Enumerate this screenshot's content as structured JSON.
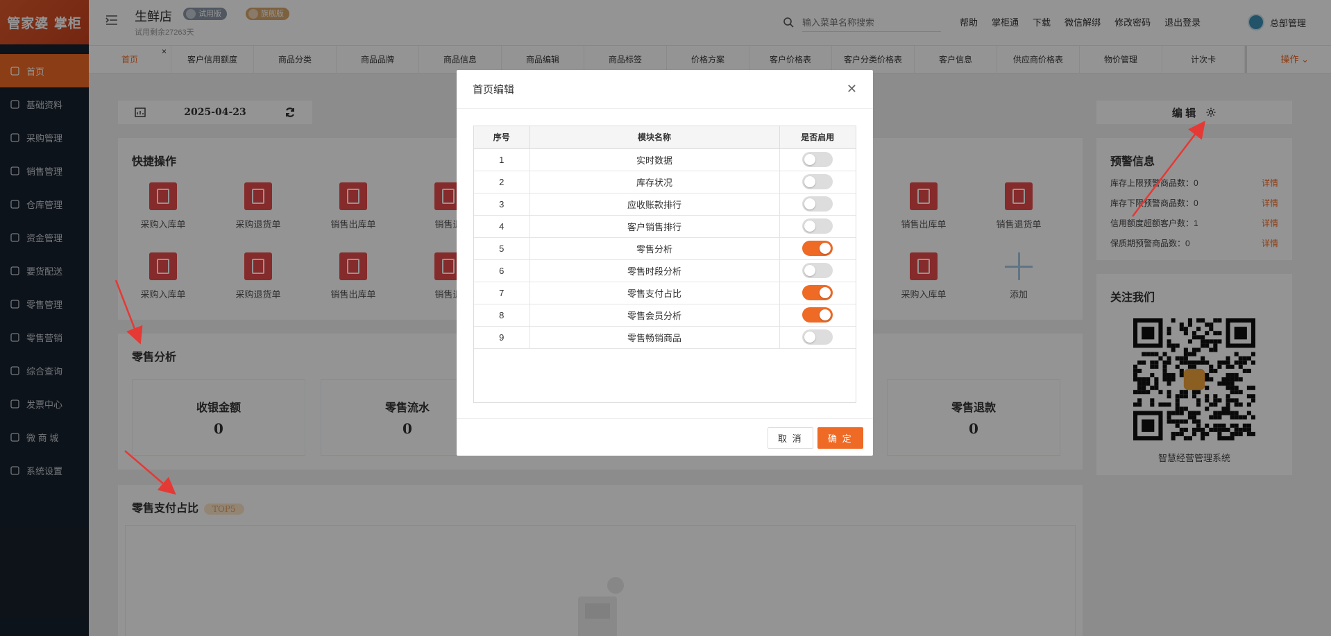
{
  "sidebar": {
    "logo": "管家婆 掌柜",
    "items": [
      {
        "label": "首页",
        "icon": "globe-icon"
      },
      {
        "label": "基础资料",
        "icon": "home-icon"
      },
      {
        "label": "采购管理",
        "icon": "cart-icon"
      },
      {
        "label": "销售管理",
        "icon": "card-icon"
      },
      {
        "label": "仓库管理",
        "icon": "bank-icon"
      },
      {
        "label": "资金管理",
        "icon": "money-icon"
      },
      {
        "label": "要货配送",
        "icon": "doc-icon"
      },
      {
        "label": "零售管理",
        "icon": "chart-icon"
      },
      {
        "label": "零售营销",
        "icon": "gift-icon"
      },
      {
        "label": "综合查询",
        "icon": "bar-icon"
      },
      {
        "label": "发票中心",
        "icon": "trend-icon"
      },
      {
        "label": "微 商 城",
        "icon": "bag-icon"
      },
      {
        "label": "系统设置",
        "icon": "gear-icon"
      }
    ]
  },
  "header": {
    "store_name": "生鲜店",
    "trial_text": "试用剩余27263天",
    "badge_trial": "试用版",
    "badge_flagship": "旗舰版",
    "search_placeholder": "输入菜单名称搜索",
    "links": [
      "帮助",
      "掌柜通",
      "下载",
      "微信解绑",
      "修改密码",
      "退出登录"
    ],
    "user": "总部管理"
  },
  "tabs": [
    "首页",
    "客户信用额度",
    "商品分类",
    "商品品牌",
    "商品信息",
    "商品编辑",
    "商品标签",
    "价格方案",
    "客户价格表",
    "客户分类价格表",
    "客户信息",
    "供应商价格表",
    "物价管理",
    "计次卡"
  ],
  "tabs_ops": "操作 ⌄",
  "dashboard": {
    "date": "2025-04-23",
    "quick_title": "快捷操作",
    "quick_row1": [
      "采购入库单",
      "采购退货单",
      "销售出库单",
      "销售退",
      "销售出库单",
      "销售退货单"
    ],
    "quick_row2": [
      "采购入库单",
      "采购退货单",
      "销售出库单",
      "销售退",
      "采购入库单",
      "添加"
    ],
    "retail_title": "零售分析",
    "stats": [
      {
        "label": "收银金额",
        "value": "0"
      },
      {
        "label": "零售流水",
        "value": "0"
      },
      {
        "label": "零售退款",
        "value": "0"
      }
    ],
    "pay_title": "零售支付占比",
    "pay_badge": "TOP5",
    "edit_label": "编 辑",
    "warn_title": "预警信息",
    "warn_rows": [
      {
        "label": "库存上限预警商品数：0",
        "link": "详情"
      },
      {
        "label": "库存下限预警商品数：0",
        "link": "详情"
      },
      {
        "label": "信用额度超额客户数：1",
        "link": "详情"
      },
      {
        "label": "保质期预警商品数：0",
        "link": "详情"
      }
    ],
    "follow_title": "关注我们",
    "follow_caption": "智慧经营管理系统"
  },
  "modal": {
    "title": "首页编辑",
    "columns": [
      "序号",
      "模块名称",
      "是否启用"
    ],
    "rows": [
      {
        "no": "1",
        "name": "实时数据",
        "enabled": false
      },
      {
        "no": "2",
        "name": "库存状况",
        "enabled": false
      },
      {
        "no": "3",
        "name": "应收账款排行",
        "enabled": false
      },
      {
        "no": "4",
        "name": "客户销售排行",
        "enabled": false
      },
      {
        "no": "5",
        "name": "零售分析",
        "enabled": true
      },
      {
        "no": "6",
        "name": "零售时段分析",
        "enabled": false
      },
      {
        "no": "7",
        "name": "零售支付占比",
        "enabled": true
      },
      {
        "no": "8",
        "name": "零售会员分析",
        "enabled": true
      },
      {
        "no": "9",
        "name": "零售畅销商品",
        "enabled": false
      }
    ],
    "cancel": "取 消",
    "ok": "确 定"
  },
  "colors": {
    "accent": "#ef6a25",
    "sidebar": "#18212d",
    "arrow": "#e53935"
  }
}
